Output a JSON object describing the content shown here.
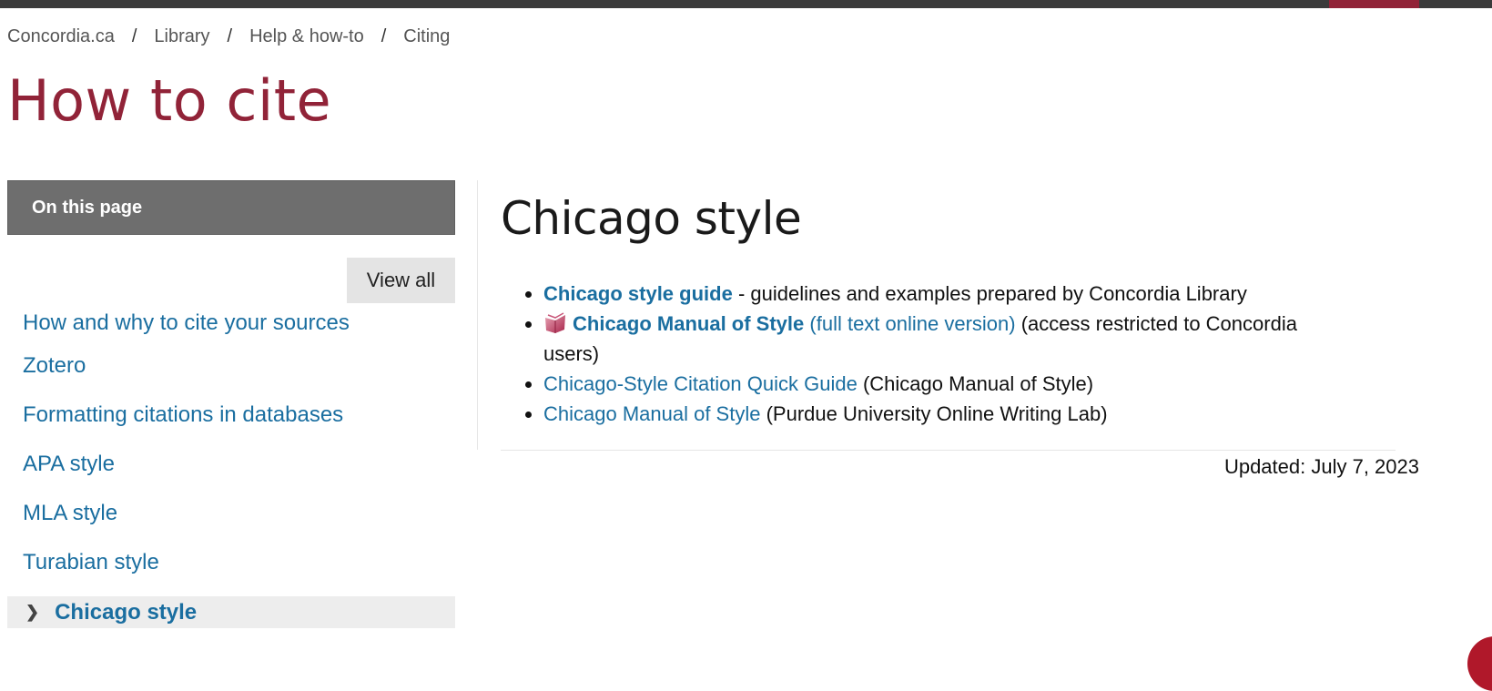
{
  "breadcrumb": {
    "items": [
      "Concordia.ca",
      "Library",
      "Help & how-to",
      "Citing"
    ],
    "separator": "/"
  },
  "page_title": "How to cite",
  "sidebar": {
    "header": "On this page",
    "view_all": "View all",
    "items": [
      {
        "label": "How and why to cite your sources"
      },
      {
        "label": "Zotero"
      },
      {
        "label": "Formatting citations in databases"
      },
      {
        "label": "APA style"
      },
      {
        "label": "MLA style"
      },
      {
        "label": "Turabian style"
      },
      {
        "label": "Chicago style",
        "active": true
      }
    ]
  },
  "main": {
    "heading": "Chicago style",
    "resources": [
      {
        "link": "Chicago style guide",
        "text": " - guidelines and examples prepared by Concordia Library"
      },
      {
        "icon": "book-icon",
        "link": "Chicago Manual of Style",
        "link2": "(full text online version)",
        "text": " (access restricted to Concordia users)"
      },
      {
        "link": "Chicago-Style Citation Quick Guide",
        "text": " (Chicago Manual of Style)"
      },
      {
        "link": "Chicago Manual of Style",
        "text": " (Purdue University Online Writing Lab)"
      }
    ],
    "updated": "Updated: July 7, 2023"
  },
  "colors": {
    "brand": "#912338",
    "link": "#1a6ea0",
    "sidebar_header": "#6e6e6e"
  }
}
